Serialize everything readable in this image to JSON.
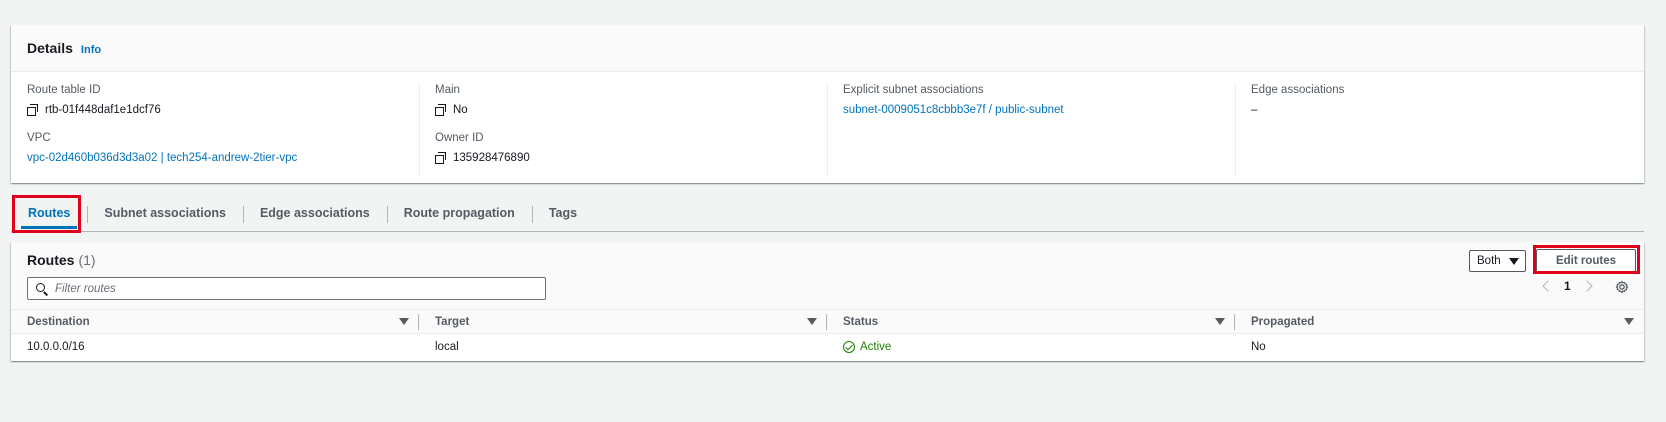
{
  "details": {
    "title": "Details",
    "info": "Info",
    "route_table_id_label": "Route table ID",
    "route_table_id": "rtb-01f448daf1e1dcf76",
    "vpc_label": "VPC",
    "vpc_value": "vpc-02d460b036d3d3a02 | tech254-andrew-2tier-vpc",
    "main_label": "Main",
    "main_value": "No",
    "owner_label": "Owner ID",
    "owner_value": "135928476890",
    "explicit_label": "Explicit subnet associations",
    "explicit_value": "subnet-0009051c8cbbb3e7f / public-subnet",
    "edge_label": "Edge associations",
    "edge_value": "–"
  },
  "tabs": [
    {
      "label": "Routes",
      "active": true
    },
    {
      "label": "Subnet associations"
    },
    {
      "label": "Edge associations"
    },
    {
      "label": "Route propagation"
    },
    {
      "label": "Tags"
    }
  ],
  "routes": {
    "title": "Routes",
    "count": "(1)",
    "filter_placeholder": "Filter routes",
    "select_value": "Both",
    "edit_button": "Edit routes",
    "page": "1",
    "columns": [
      "Destination",
      "Target",
      "Status",
      "Propagated"
    ],
    "rows": [
      {
        "destination": "10.0.0.0/16",
        "target": "local",
        "status": "Active",
        "propagated": "No"
      }
    ]
  },
  "colors": {
    "accent": "#0073bb",
    "highlight": "#e0001b",
    "status_active": "#1d8102"
  }
}
